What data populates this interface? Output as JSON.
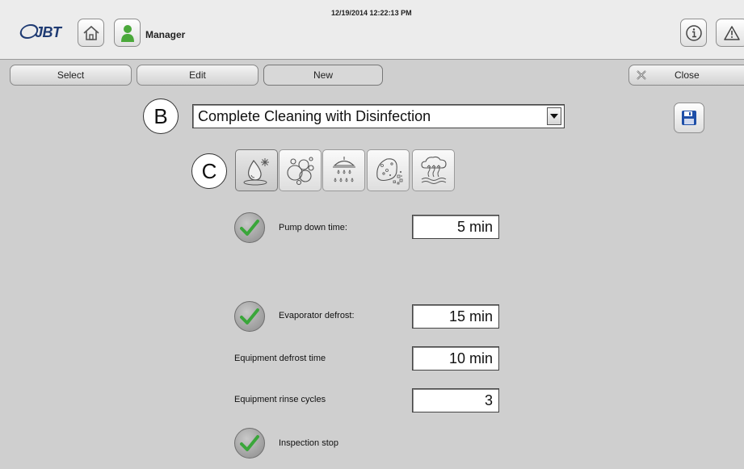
{
  "header": {
    "logo_text": "JBT",
    "datetime": "12/19/2014 12:22:13 PM",
    "user_role": "Manager",
    "icons": {
      "home": "home-icon",
      "user": "user-icon",
      "info": "info-icon",
      "warning": "warning-icon"
    }
  },
  "tabs": {
    "select_label": "Select",
    "edit_label": "Edit",
    "new_label": "New",
    "close_label": "Close"
  },
  "annotations": {
    "b": "B",
    "c": "C"
  },
  "program": {
    "selected": "Complete Cleaning with Disinfection"
  },
  "phases": [
    {
      "name": "defrost-phase",
      "icon": "water-drop-snowflake-icon",
      "active": true
    },
    {
      "name": "foam-phase",
      "icon": "foam-bubbles-icon",
      "active": false
    },
    {
      "name": "rinse-phase",
      "icon": "shower-spray-icon",
      "active": false
    },
    {
      "name": "disinfection-phase",
      "icon": "disinfection-particles-icon",
      "active": false
    },
    {
      "name": "drying-phase",
      "icon": "steam-cloud-icon",
      "active": false
    }
  ],
  "settings": {
    "pump_down_label": "Pump down time:",
    "pump_down_value": "5 min",
    "evaporator_defrost_label": "Evaporator defrost:",
    "evaporator_defrost_value": "15 min",
    "equipment_defrost_label": "Equipment defrost time",
    "equipment_defrost_value": "10 min",
    "rinse_cycles_label": "Equipment rinse cycles",
    "rinse_cycles_value": "3",
    "inspection_stop_label": "Inspection stop"
  },
  "colors": {
    "background": "#cfcfcf",
    "header_bg": "#ececec",
    "check_green": "#3aa63a",
    "user_green": "#4aa83a",
    "save_blue": "#1e4fa8"
  }
}
